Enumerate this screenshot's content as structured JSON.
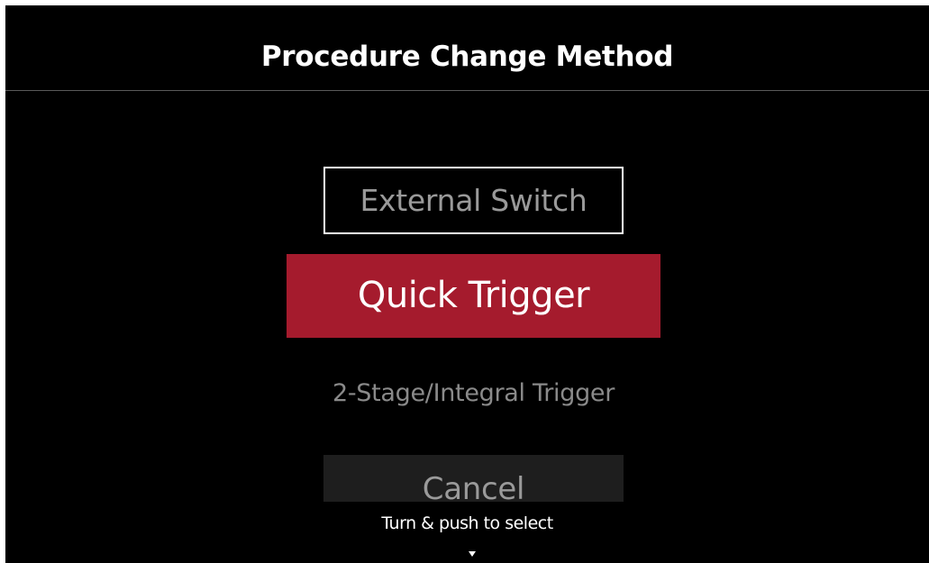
{
  "header": {
    "title": "Procedure Change Method"
  },
  "menu": {
    "options": [
      {
        "label": "External Switch",
        "state": "focused"
      },
      {
        "label": "Quick Trigger",
        "state": "selected"
      },
      {
        "label": "2-Stage/Integral Trigger",
        "state": "normal"
      },
      {
        "label": "Cancel",
        "state": "partially-visible"
      }
    ]
  },
  "footer": {
    "hint": "Turn & push to select",
    "scroll_indicator_icon": "triangle-down-icon"
  },
  "colors": {
    "background": "#000000",
    "selected_fill": "#a51b2d",
    "focus_border": "#ffffff",
    "inactive_text": "#9a9a9a",
    "cancel_fill": "#1e1e1e"
  }
}
